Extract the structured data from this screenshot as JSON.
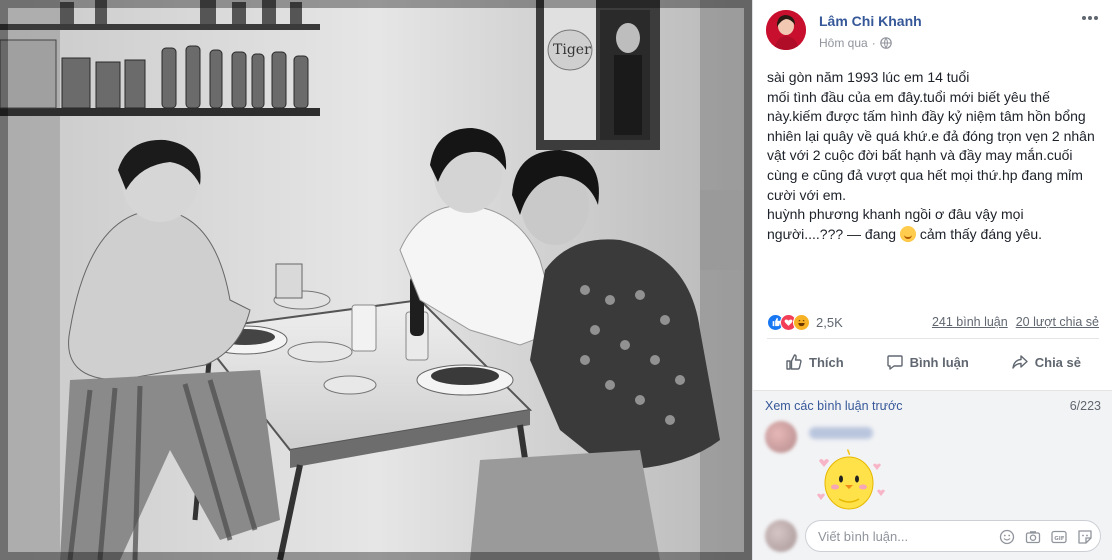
{
  "post": {
    "author": "Lâm Chi Khanh",
    "timestamp": "Hôm qua",
    "audience_icon": "globe-icon",
    "text_lines": [
      "sài gòn năm 1993 lúc em 14 tuổi",
      "mối tình đầu của em đây.tuổi mới biết yêu thế",
      "này.kiếm được tấm hình đầy kỷ niệm tâm hồn bổng",
      "nhiên lại quây về quá khứ.e đả đóng trọn vẹn 2 nhân",
      "vật với 2 cuộc đời bất hạnh và đầy may mắn.cuối",
      "cùng e cũng đả vượt qua hết mọi thứ.hp đang mỉm",
      "cười với em.",
      "huỳnh phương khanh ngồi ơ đâu vậy mọi"
    ],
    "last_line_prefix": "người....??? — đang",
    "last_line_suffix": "cảm thấy đáng yêu."
  },
  "stats": {
    "reactions_count": "2,5K",
    "comments_label": "241 bình luận",
    "shares_label": "20 lượt chia sẻ"
  },
  "actions": {
    "like": "Thích",
    "comment": "Bình luận",
    "share": "Chia sẻ"
  },
  "comments": {
    "previous_label": "Xem các bình luận trước",
    "count_label": "6/223"
  },
  "composer": {
    "placeholder": "Viết bình luận..."
  },
  "colors": {
    "link_blue": "#365899",
    "text": "#1d2129",
    "muted": "#606770",
    "like_blue": "#1877f2",
    "love_red": "#f33e58",
    "haha_yellow": "#f7b125"
  }
}
